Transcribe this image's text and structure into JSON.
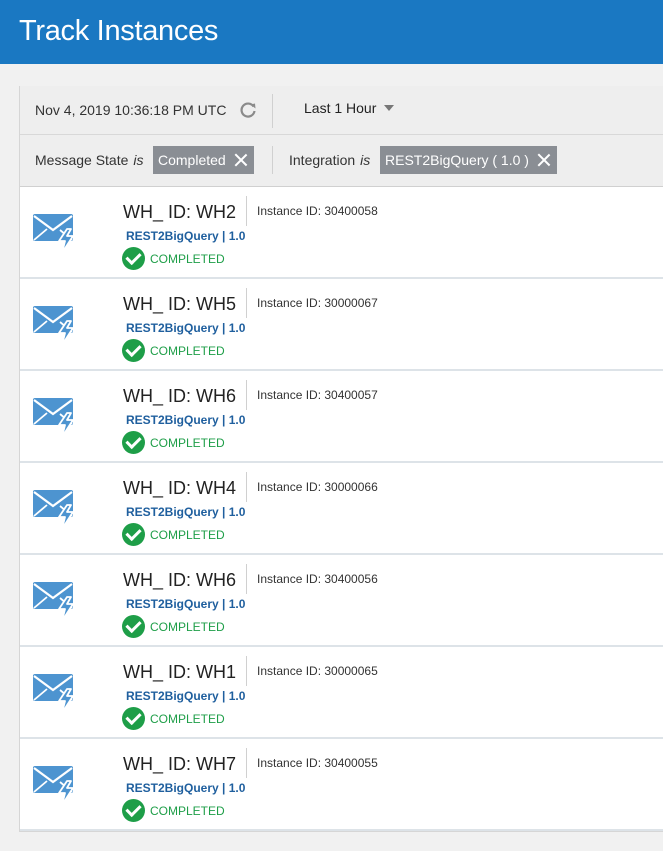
{
  "header": {
    "title": "Track Instances"
  },
  "toolbar": {
    "timestamp": "Nov 4, 2019 10:36:18 PM UTC",
    "time_range": "Last 1 Hour"
  },
  "filters": {
    "message_state_label": "Message State",
    "message_state_op": "is",
    "message_state_value": "Completed",
    "integration_label": "Integration",
    "integration_op": "is",
    "integration_value": "REST2BigQuery ( 1.0 )"
  },
  "colors": {
    "header_bg": "#1a78c2",
    "link": "#1f5f9e",
    "status_ok": "#1e9e48",
    "chip_bg": "#8a8e94"
  },
  "instances": [
    {
      "name": "WH_ ID: WH2",
      "instance_id": "Instance ID: 30400058",
      "integration": "REST2BigQuery | 1.0",
      "status": "COMPLETED"
    },
    {
      "name": "WH_ ID: WH5",
      "instance_id": "Instance ID: 30000067",
      "integration": "REST2BigQuery | 1.0",
      "status": "COMPLETED"
    },
    {
      "name": "WH_ ID: WH6",
      "instance_id": "Instance ID: 30400057",
      "integration": "REST2BigQuery | 1.0",
      "status": "COMPLETED"
    },
    {
      "name": "WH_ ID: WH4",
      "instance_id": "Instance ID: 30000066",
      "integration": "REST2BigQuery | 1.0",
      "status": "COMPLETED"
    },
    {
      "name": "WH_ ID: WH6",
      "instance_id": "Instance ID: 30400056",
      "integration": "REST2BigQuery | 1.0",
      "status": "COMPLETED"
    },
    {
      "name": "WH_ ID: WH1",
      "instance_id": "Instance ID: 30000065",
      "integration": "REST2BigQuery | 1.0",
      "status": "COMPLETED"
    },
    {
      "name": "WH_ ID: WH7",
      "instance_id": "Instance ID: 30400055",
      "integration": "REST2BigQuery | 1.0",
      "status": "COMPLETED"
    }
  ]
}
